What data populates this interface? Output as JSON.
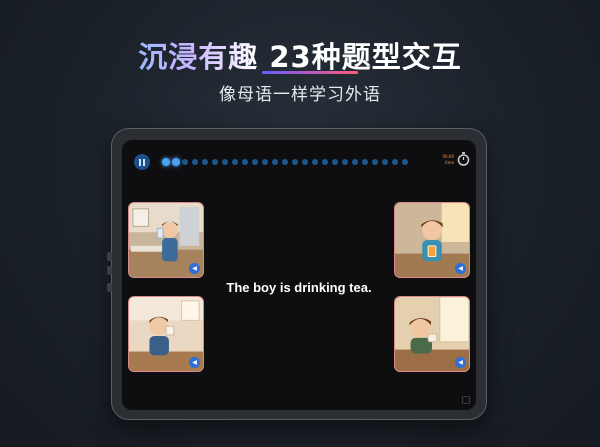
{
  "hero": {
    "title_part1": "沉浸有趣",
    "title_part2": "23种题型交互",
    "subtitle": "像母语一样学习外语"
  },
  "lesson": {
    "sentence": "The boy is drinking tea.",
    "progress": {
      "total_steps": 25,
      "current_step": 2
    },
    "timer_label_1": "00:00",
    "timer_label_2": "time",
    "cards": [
      {
        "name": "card-top-left",
        "scene": "boy drinking from glass in kitchen",
        "audio_icon": "speaker-icon"
      },
      {
        "name": "card-bottom-left",
        "scene": "boy drinking from cup in kitchen",
        "audio_icon": "speaker-icon"
      },
      {
        "name": "card-top-right",
        "scene": "boy holding glass of juice",
        "audio_icon": "speaker-icon"
      },
      {
        "name": "card-bottom-right",
        "scene": "boy sipping tea at table",
        "audio_icon": "speaker-icon"
      }
    ]
  },
  "colors": {
    "accent_blue": "#4aa2f2",
    "card_border": "#d98a8a",
    "speaker_bg": "#2f6fd6",
    "timer_orange": "#ff8a3d"
  }
}
